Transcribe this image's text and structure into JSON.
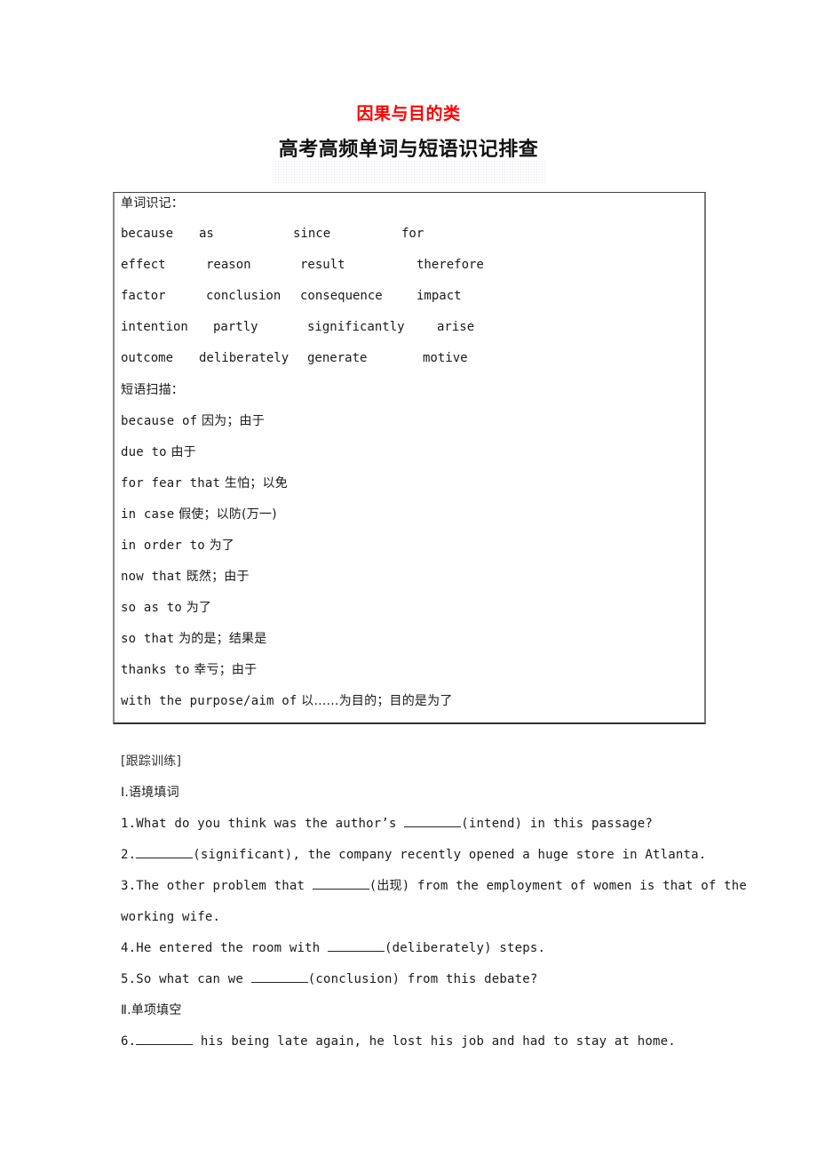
{
  "header": {
    "category": "因果与目的类",
    "title": "高考高频单词与短语识记排查"
  },
  "box": {
    "words_heading": "单词识记：",
    "word_rows": [
      [
        "because",
        "as",
        "since",
        "for"
      ],
      [
        "effect",
        "reason",
        "result",
        "therefore"
      ],
      [
        "factor",
        "conclusion",
        "consequence",
        "impact"
      ],
      [
        "intention",
        "partly",
        "significantly",
        "arise"
      ],
      [
        "outcome",
        "deliberately",
        "generate",
        "motive"
      ]
    ],
    "phrases_heading": "短语扫描：",
    "phrases": [
      {
        "en": "because of",
        "cn": "因为；由于"
      },
      {
        "en": "due to",
        "cn": "由于"
      },
      {
        "en": "for fear that",
        "cn": "生怕；以免"
      },
      {
        "en": "in case",
        "cn": "假使；以防(万一)"
      },
      {
        "en": "in order to",
        "cn": "为了"
      },
      {
        "en": "now that",
        "cn": "既然；由于"
      },
      {
        "en": "so as to",
        "cn": "为了"
      },
      {
        "en": "so that",
        "cn": "为的是；结果是"
      },
      {
        "en": "thanks to",
        "cn": "幸亏；由于"
      },
      {
        "en": "with the purpose/aim of",
        "cn": "以……为目的；目的是为了"
      }
    ]
  },
  "exercises": {
    "heading": "[跟踪训练]",
    "section1": "Ⅰ.语境填词",
    "q1": {
      "pre": "1.What do you think was the author’s ",
      "hint": "(intend) in this passage?"
    },
    "q2": {
      "pre": "2.",
      "hint": "(significant), the company recently opened a huge store in Atlanta."
    },
    "q3": {
      "pre": "3.The other problem that ",
      "hint": "(出现) from the employment of women is that of the",
      "cont": "working wife."
    },
    "q4": {
      "pre": "4.He entered the room with ",
      "hint": "(deliberately) steps."
    },
    "q5": {
      "pre": "5.So what can we ",
      "hint": "(conclusion) from this debate?"
    },
    "section2": "Ⅱ.单项填空",
    "q6": {
      "pre": "6.",
      "hint": " his being late again, he lost his job and had to stay at home."
    }
  }
}
